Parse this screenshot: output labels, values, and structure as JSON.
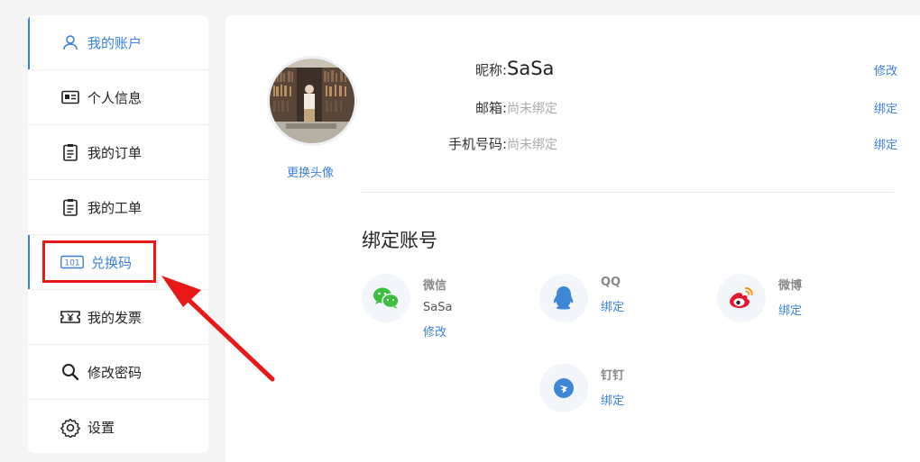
{
  "sidebar": {
    "items": [
      {
        "label": "我的账户"
      },
      {
        "label": "个人信息"
      },
      {
        "label": "我的订单"
      },
      {
        "label": "我的工单"
      },
      {
        "label": "兑换码",
        "icon_text": "101"
      },
      {
        "label": "我的发票"
      },
      {
        "label": "修改密码"
      },
      {
        "label": "设置"
      }
    ]
  },
  "profile": {
    "change_avatar": "更换头像",
    "nickname_label": "昵称:",
    "nickname": "SaSa",
    "nickname_action": "修改",
    "email_label": "邮箱:",
    "email": "尚未绑定",
    "email_action": "绑定",
    "phone_label": "手机号码:",
    "phone": "尚未绑定",
    "phone_action": "绑定"
  },
  "bind": {
    "title": "绑定账号",
    "wechat": {
      "name": "微信",
      "value": "SaSa",
      "action": "修改"
    },
    "qq": {
      "name": "QQ",
      "action": "绑定"
    },
    "weibo": {
      "name": "微博",
      "action": "绑定"
    },
    "dingtalk": {
      "name": "钉钉",
      "action": "绑定"
    }
  },
  "colors": {
    "accent": "#3b7fe0",
    "highlight": "#e81818"
  }
}
